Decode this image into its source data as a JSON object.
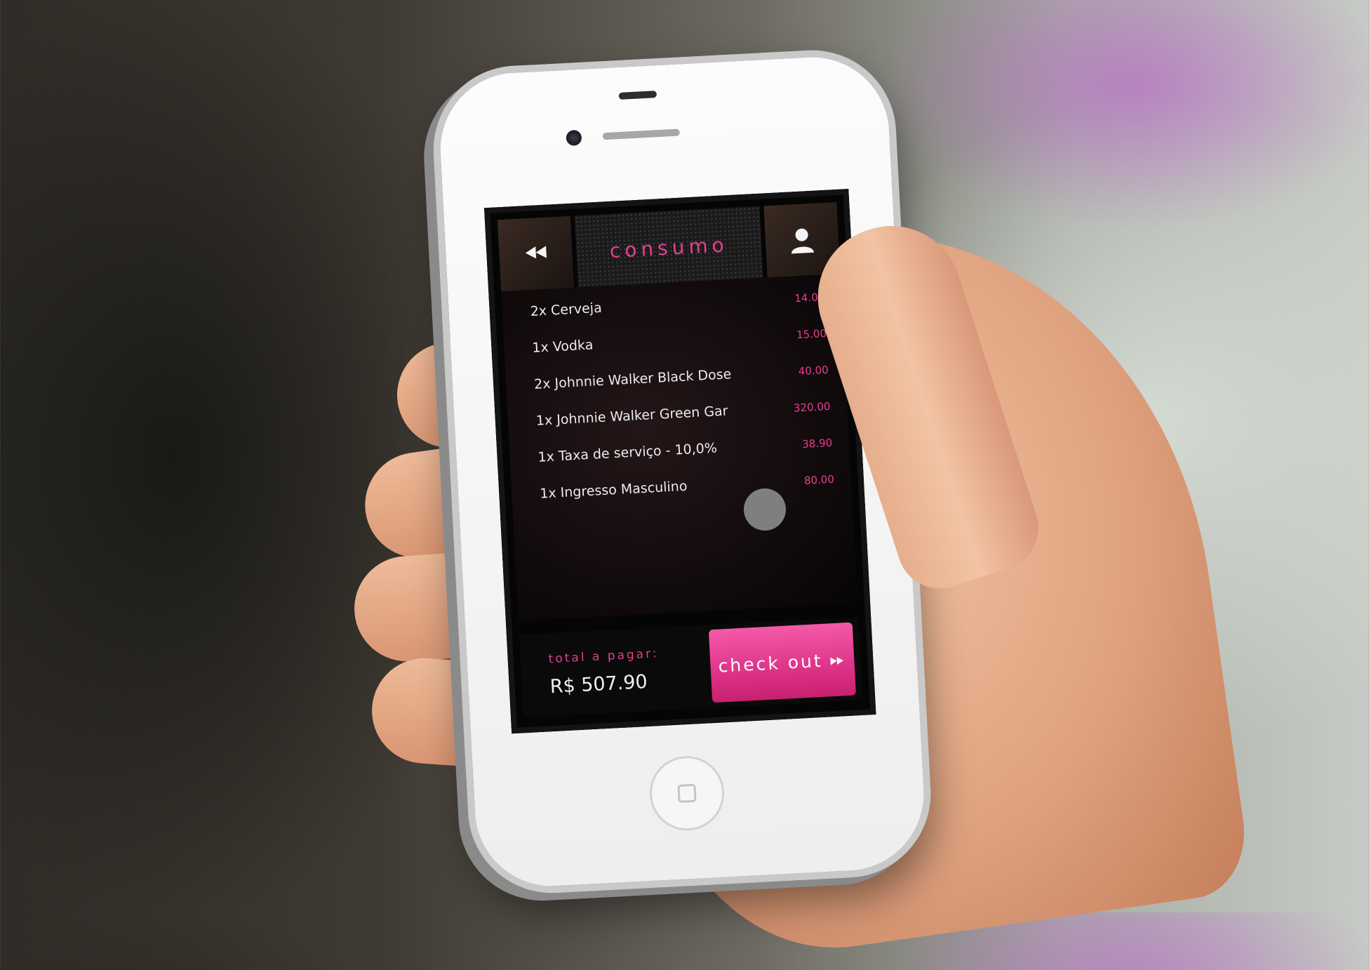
{
  "app": {
    "title": "consumo",
    "back_icon": "rewind-icon",
    "profile_icon": "user-icon"
  },
  "order": {
    "items": [
      {
        "label": "2x Cerveja",
        "price": "14.00"
      },
      {
        "label": "1x Vodka",
        "price": "15.00"
      },
      {
        "label": "2x Johnnie Walker Black Dose",
        "price": "40.00"
      },
      {
        "label": "1x Johnnie Walker Green Gar",
        "price": "320.00"
      },
      {
        "label": "1x Taxa de serviço - 10,0%",
        "price": "38.90"
      },
      {
        "label": "1x Ingresso Masculino",
        "price": "80.00"
      }
    ]
  },
  "footer": {
    "total_label": "total a pagar:",
    "total_value": "R$ 507.90",
    "checkout_label": "check out",
    "checkout_icon": "fast-forward-icon"
  },
  "colors": {
    "accent": "#e2408f",
    "screen_bg": "#050505"
  }
}
